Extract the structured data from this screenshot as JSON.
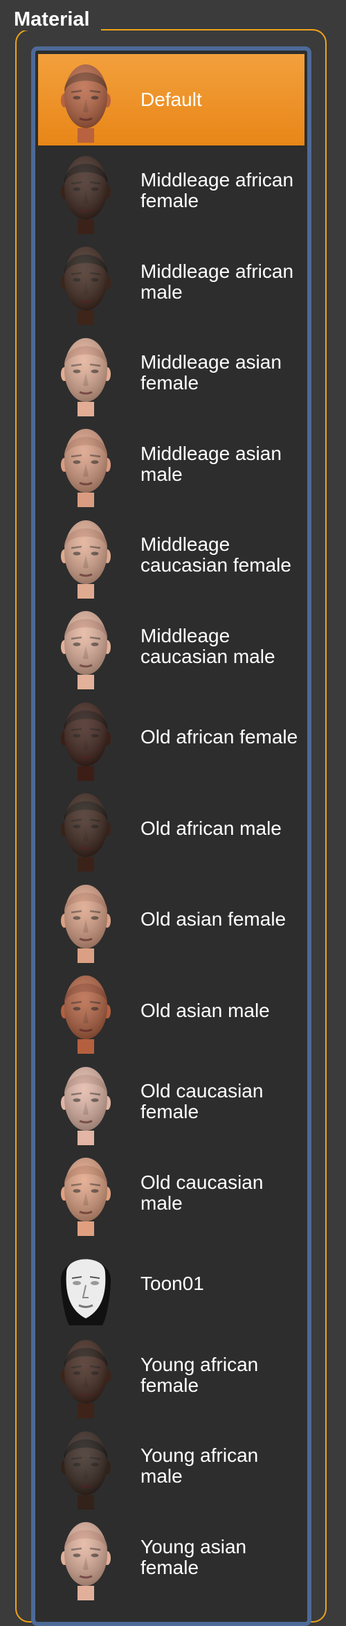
{
  "panel": {
    "title": "Material"
  },
  "materials": [
    {
      "label": "Default",
      "skin": "#b8623f",
      "hair": "#6f3a22",
      "selected": true
    },
    {
      "label": "Middleage african female",
      "skin": "#3a2219",
      "hair": "#140c09"
    },
    {
      "label": "Middleage african male",
      "skin": "#3d251a",
      "hair": "#15100c"
    },
    {
      "label": "Middleage asian female",
      "skin": "#e2ad94",
      "hair": "#c98f78"
    },
    {
      "label": "Middleage asian male",
      "skin": "#d99c80",
      "hair": "#bf8266"
    },
    {
      "label": "Middleage caucasian female",
      "skin": "#e0aa90",
      "hair": "#c88e76"
    },
    {
      "label": "Middleage caucasian male",
      "skin": "#e3b19a",
      "hair": "#c9927d"
    },
    {
      "label": "Old african female",
      "skin": "#3c1e16",
      "hair": "#1b0d09"
    },
    {
      "label": "Old african male",
      "skin": "#3a2218",
      "hair": "#17100b"
    },
    {
      "label": "Old asian female",
      "skin": "#dba084",
      "hair": "#c5876c"
    },
    {
      "label": "Old asian male",
      "skin": "#b4603e",
      "hair": "#94472c"
    },
    {
      "label": "Old caucasian female",
      "skin": "#e2b5a5",
      "hair": "#c99a8a"
    },
    {
      "label": "Old caucasian male",
      "skin": "#e0a080",
      "hair": "#c78465"
    },
    {
      "label": "Toon01",
      "skin": "#e8e8e8",
      "hair": "#111111",
      "toon": true
    },
    {
      "label": "Young african female",
      "skin": "#3e2318",
      "hair": "#160d09"
    },
    {
      "label": "Young african male",
      "skin": "#33221a",
      "hair": "#110c09"
    },
    {
      "label": "Young asian female",
      "skin": "#e2b09a",
      "hair": "#cc9580"
    }
  ]
}
